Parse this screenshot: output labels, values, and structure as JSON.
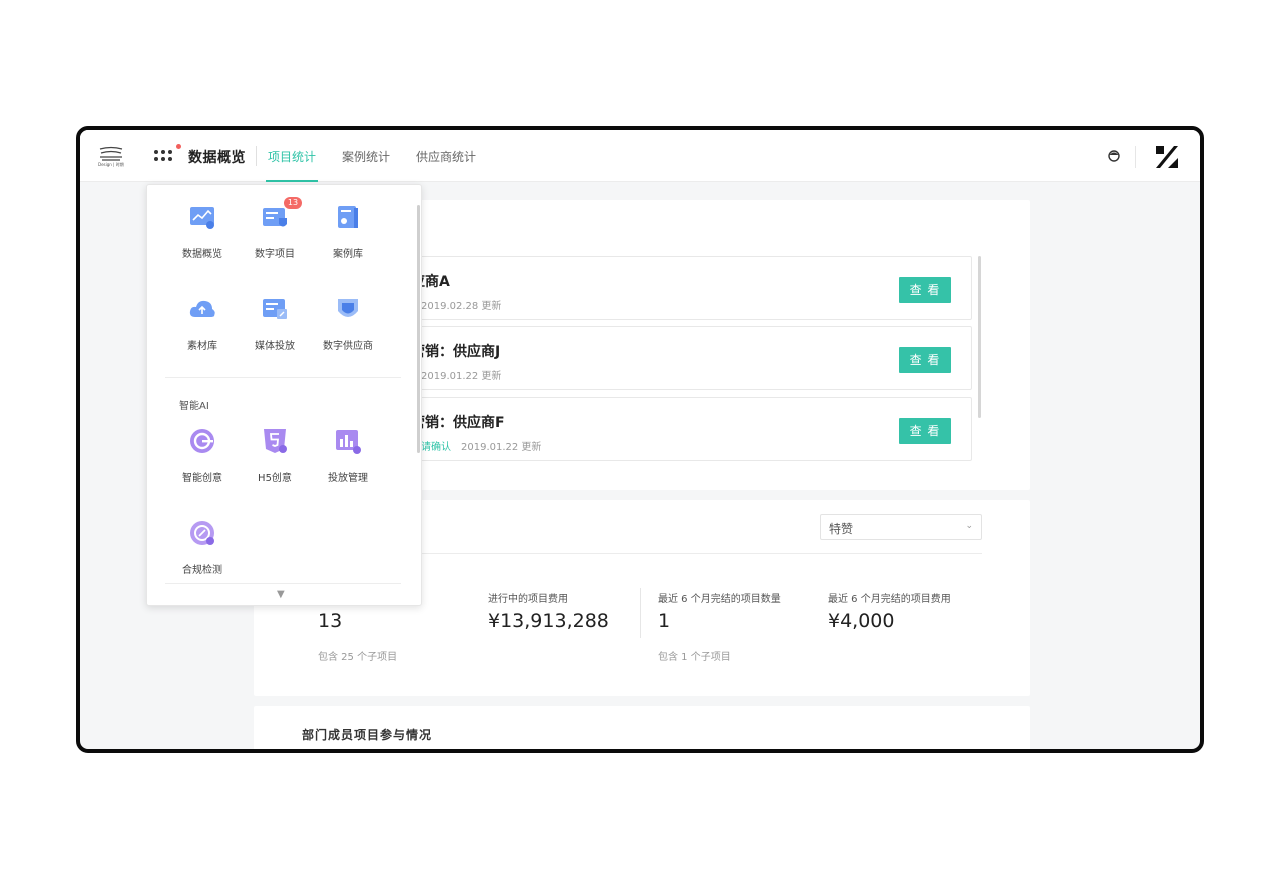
{
  "header": {
    "logo_text": "Design | 时期",
    "brand_title": "数据概览",
    "tabs": [
      {
        "label": "项目统计",
        "active": true
      },
      {
        "label": "案例统计",
        "active": false
      },
      {
        "label": "供应商统计",
        "active": false
      }
    ],
    "accent_color": "#2fc3a7"
  },
  "launcher": {
    "apps": [
      {
        "label": "数据概览",
        "icon": "chart-board-icon"
      },
      {
        "label": "数字项目",
        "icon": "project-card-icon",
        "badge": "13"
      },
      {
        "label": "案例库",
        "icon": "case-book-icon"
      },
      {
        "label": "素材库",
        "icon": "cloud-upload-icon"
      },
      {
        "label": "媒体投放",
        "icon": "media-ad-icon"
      },
      {
        "label": "数字供应商",
        "icon": "supplier-shield-icon"
      }
    ],
    "section_title": "智能AI",
    "ai_apps": [
      {
        "label": "智能创意",
        "icon": "creative-ring-icon"
      },
      {
        "label": "H5创意",
        "icon": "html5-icon"
      },
      {
        "label": "投放管理",
        "icon": "bar-chart-icon"
      },
      {
        "label": "合规检测",
        "icon": "compliance-icon"
      }
    ]
  },
  "suppliers": [
    {
      "title": "应商A",
      "status": "",
      "date": "2019.02.28 更新",
      "button": "查 看"
    },
    {
      "title": "营销：供应商J",
      "status": "",
      "date": "2019.01.22 更新",
      "button": "查 看"
    },
    {
      "title": "营销：供应商F",
      "status": "，请确认",
      "date": "2019.01.22 更新",
      "button": "查 看"
    }
  ],
  "stats": {
    "select_value": "特赞",
    "items": [
      {
        "label": "",
        "value": "13",
        "note": "包含 25 个子项目"
      },
      {
        "label": "进行中的项目费用",
        "value": "¥13,913,288",
        "note": ""
      },
      {
        "label": "最近 6 个月完结的项目数量",
        "value": "1",
        "note": "包含 1 个子项目"
      },
      {
        "label": "最近 6 个月完结的项目费用",
        "value": "¥4,000",
        "note": ""
      }
    ]
  },
  "members_section": {
    "title": "部门成员项目参与情况"
  }
}
